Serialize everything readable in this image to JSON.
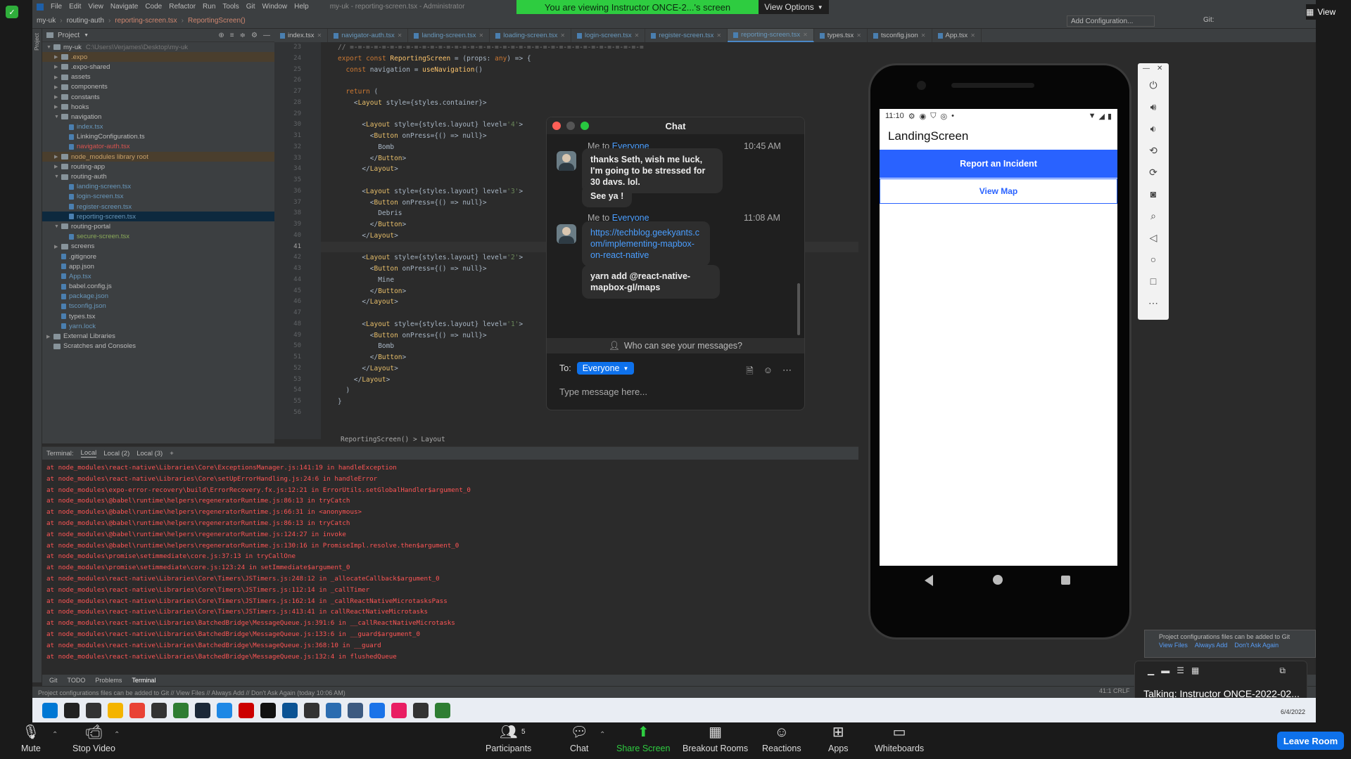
{
  "zoom": {
    "banner_text": "You are viewing Instructor ONCE-2...'s screen",
    "view_options": "View Options",
    "view_label": "View",
    "toolbar": {
      "mute": "Mute",
      "stop_video": "Stop Video",
      "participants": "Participants",
      "participants_count": "5",
      "chat": "Chat",
      "share_screen": "Share Screen",
      "breakout_rooms": "Breakout Rooms",
      "reactions": "Reactions",
      "apps": "Apps",
      "whiteboards": "Whiteboards",
      "leave": "Leave Room"
    },
    "talking": "Talking: Instructor ONCE-2022-02..."
  },
  "ide": {
    "menu": [
      "File",
      "Edit",
      "View",
      "Navigate",
      "Code",
      "Refactor",
      "Run",
      "Tools",
      "Git",
      "Window",
      "Help"
    ],
    "window_title": "my-uk - reporting-screen.tsx - Administrator",
    "breadcrumb": [
      "my-uk",
      "routing-auth",
      "reporting-screen.tsx",
      "ReportingScreen()"
    ],
    "add_configuration": "Add Configuration...",
    "git_label": "Git:",
    "project_label": "Project",
    "project_tree": [
      {
        "indent": 0,
        "arrow": "v",
        "type": "folder",
        "name": "my-uk",
        "suffix": "C:\\Users\\Verjames\\Desktop\\my-uk",
        "color": ""
      },
      {
        "indent": 1,
        "arrow": ">",
        "type": "folder",
        "name": ".expo",
        "color": "excluded"
      },
      {
        "indent": 1,
        "arrow": ">",
        "type": "folder",
        "name": ".expo-shared",
        "color": ""
      },
      {
        "indent": 1,
        "arrow": ">",
        "type": "folder",
        "name": "assets",
        "color": ""
      },
      {
        "indent": 1,
        "arrow": ">",
        "type": "folder",
        "name": "components",
        "color": ""
      },
      {
        "indent": 1,
        "arrow": ">",
        "type": "folder",
        "name": "constants",
        "color": ""
      },
      {
        "indent": 1,
        "arrow": ">",
        "type": "folder",
        "name": "hooks",
        "color": ""
      },
      {
        "indent": 1,
        "arrow": "v",
        "type": "folder",
        "name": "navigation",
        "color": ""
      },
      {
        "indent": 2,
        "arrow": "",
        "type": "file",
        "name": "index.tsx",
        "color": "blue"
      },
      {
        "indent": 2,
        "arrow": "",
        "type": "file",
        "name": "LinkingConfiguration.ts",
        "color": ""
      },
      {
        "indent": 2,
        "arrow": "",
        "type": "file",
        "name": "navigator-auth.tsx",
        "color": "red"
      },
      {
        "indent": 1,
        "arrow": ">",
        "type": "folder",
        "name": "node_modules  library root",
        "color": "excluded"
      },
      {
        "indent": 1,
        "arrow": ">",
        "type": "folder",
        "name": "routing-app",
        "color": ""
      },
      {
        "indent": 1,
        "arrow": "v",
        "type": "folder",
        "name": "routing-auth",
        "color": ""
      },
      {
        "indent": 2,
        "arrow": "",
        "type": "file",
        "name": "landing-screen.tsx",
        "color": "blue"
      },
      {
        "indent": 2,
        "arrow": "",
        "type": "file",
        "name": "login-screen.tsx",
        "color": "blue"
      },
      {
        "indent": 2,
        "arrow": "",
        "type": "file",
        "name": "register-screen.tsx",
        "color": "blue"
      },
      {
        "indent": 2,
        "arrow": "",
        "type": "file",
        "name": "reporting-screen.tsx",
        "color": "selected"
      },
      {
        "indent": 1,
        "arrow": "v",
        "type": "folder",
        "name": "routing-portal",
        "color": ""
      },
      {
        "indent": 2,
        "arrow": "",
        "type": "file",
        "name": "secure-screen.tsx",
        "color": "green"
      },
      {
        "indent": 1,
        "arrow": ">",
        "type": "folder",
        "name": "screens",
        "color": ""
      },
      {
        "indent": 1,
        "arrow": "",
        "type": "file",
        "name": ".gitignore",
        "color": ""
      },
      {
        "indent": 1,
        "arrow": "",
        "type": "file",
        "name": "app.json",
        "color": ""
      },
      {
        "indent": 1,
        "arrow": "",
        "type": "file",
        "name": "App.tsx",
        "color": "blue"
      },
      {
        "indent": 1,
        "arrow": "",
        "type": "file",
        "name": "babel.config.js",
        "color": ""
      },
      {
        "indent": 1,
        "arrow": "",
        "type": "file",
        "name": "package.json",
        "color": "blue"
      },
      {
        "indent": 1,
        "arrow": "",
        "type": "file",
        "name": "tsconfig.json",
        "color": "blue"
      },
      {
        "indent": 1,
        "arrow": "",
        "type": "file",
        "name": "types.tsx",
        "color": ""
      },
      {
        "indent": 1,
        "arrow": "",
        "type": "file",
        "name": "yarn.lock",
        "color": "blue"
      },
      {
        "indent": 0,
        "arrow": ">",
        "type": "folder",
        "name": "External Libraries",
        "color": ""
      },
      {
        "indent": 0,
        "arrow": "",
        "type": "folder",
        "name": "Scratches and Consoles",
        "color": ""
      }
    ],
    "tabs": [
      {
        "name": "index.tsx",
        "active": false
      },
      {
        "name": "navigator-auth.tsx",
        "active": false
      },
      {
        "name": "landing-screen.tsx",
        "active": false
      },
      {
        "name": "loading-screen.tsx",
        "active": false
      },
      {
        "name": "login-screen.tsx",
        "active": false
      },
      {
        "name": "register-screen.tsx",
        "active": false
      },
      {
        "name": "reporting-screen.tsx",
        "active": true
      },
      {
        "name": "types.tsx",
        "active": false
      },
      {
        "name": "tsconfig.json",
        "active": false
      },
      {
        "name": "App.tsx",
        "active": false
      }
    ],
    "line_numbers": [
      "23",
      "24",
      "25",
      "26",
      "27",
      "28",
      "29",
      "30",
      "31",
      "32",
      "33",
      "34",
      "35",
      "36",
      "37",
      "38",
      "39",
      "40",
      "41",
      "42",
      "43",
      "44",
      "45",
      "46",
      "47",
      "48",
      "49",
      "50",
      "51",
      "52",
      "53",
      "54",
      "55",
      "56"
    ],
    "code_lines": [
      "// =-=-=-=-=-=-=-=-=-=-=-=-=-=-=-=-=-=-=-=-=-=-=-=-=-=-=-=-=-=-=-=-=-=-=-=-=",
      "export const ReportingScreen = (props: any) => {",
      "  const navigation = useNavigation()",
      "",
      "  return (",
      "    <Layout style={styles.container}>",
      "",
      "      <Layout style={styles.layout} level='4'>",
      "        <Button onPress={() => null}>",
      "          Bomb",
      "        </Button>",
      "      </Layout>",
      "",
      "      <Layout style={styles.layout} level='3'>",
      "        <Button onPress={() => null}>",
      "          Debris",
      "        </Button>",
      "      </Layout>",
      "",
      "      <Layout style={styles.layout} level='2'>",
      "        <Button onPress={() => null}>",
      "          Mine",
      "        </Button>",
      "      </Layout>",
      "",
      "      <Layout style={styles.layout} level='1'>",
      "        <Button onPress={() => null}>",
      "          Bomb",
      "        </Button>",
      "      </Layout>",
      "    </Layout>",
      "  )",
      "}",
      ""
    ],
    "code_breadcrumb": "ReportingScreen()  >  Layout",
    "terminal_tabs": [
      "Terminal:",
      "Local",
      "Local (2)",
      "Local (3)"
    ],
    "terminal_lines": [
      "at node_modules\\react-native\\Libraries\\Core\\ExceptionsManager.js:141:19 in handleException",
      "at node_modules\\react-native\\Libraries\\Core\\setUpErrorHandling.js:24:6 in handleError",
      "at node_modules\\expo-error-recovery\\build\\ErrorRecovery.fx.js:12:21 in ErrorUtils.setGlobalHandler$argument_0",
      "at node_modules\\@babel\\runtime\\helpers\\regeneratorRuntime.js:86:13 in tryCatch",
      "at node_modules\\@babel\\runtime\\helpers\\regeneratorRuntime.js:66:31 in <anonymous>",
      "at node_modules\\@babel\\runtime\\helpers\\regeneratorRuntime.js:86:13 in tryCatch",
      "at node_modules\\@babel\\runtime\\helpers\\regeneratorRuntime.js:124:27 in invoke",
      "at node_modules\\@babel\\runtime\\helpers\\regeneratorRuntime.js:130:16 in PromiseImpl.resolve.then$argument_0",
      "at node_modules\\promise\\setimmediate\\core.js:37:13 in tryCallOne",
      "at node_modules\\promise\\setimmediate\\core.js:123:24 in setImmediate$argument_0",
      "at node_modules\\react-native\\Libraries\\Core\\Timers\\JSTimers.js:248:12 in _allocateCallback$argument_0",
      "at node_modules\\react-native\\Libraries\\Core\\Timers\\JSTimers.js:112:14 in _callTimer",
      "at node_modules\\react-native\\Libraries\\Core\\Timers\\JSTimers.js:162:14 in _callReactNativeMicrotasksPass",
      "at node_modules\\react-native\\Libraries\\Core\\Timers\\JSTimers.js:413:41 in callReactNativeMicrotasks",
      "at node_modules\\react-native\\Libraries\\BatchedBridge\\MessageQueue.js:391:6 in __callReactNativeMicrotasks",
      "at node_modules\\react-native\\Libraries\\BatchedBridge\\MessageQueue.js:133:6 in __guard$argument_0",
      "at node_modules\\react-native\\Libraries\\BatchedBridge\\MessageQueue.js:368:10 in __guard",
      "at node_modules\\react-native\\Libraries\\BatchedBridge\\MessageQueue.js:132:4 in flushedQueue"
    ],
    "bottom_tabs": [
      "Git",
      "TODO",
      "Problems",
      "Terminal"
    ],
    "status_text": "Project configurations files can be added to Git // View Files // Always Add // Don't Ask Again (today 10:06 AM)",
    "status_right": "41:1  CRLF",
    "notification": {
      "text": "Project configurations files can be added to Git",
      "links": [
        "View Files",
        "Always Add",
        "Don't Ask Again"
      ]
    },
    "taskbar_date": "6/4/2022"
  },
  "emulator": {
    "time": "11:10",
    "app_title": "LandingScreen",
    "report_button": "Report an Incident",
    "view_map_button": "View Map"
  },
  "chat": {
    "title": "Chat",
    "messages": [
      {
        "from": "Me to",
        "to": "Everyone",
        "time": "10:45 AM",
        "bubbles": [
          "thanks Seth, wish me luck, I'm going to be stressed for 30 days. lol.",
          "See ya !"
        ]
      },
      {
        "from": "Me to",
        "to": "Everyone",
        "time": "11:08 AM",
        "bubbles": [
          "https://techblog.geekyants.com/implementing-mapbox-on-react-native",
          "yarn add @react-native-mapbox-gl/maps"
        ]
      }
    ],
    "who_can_see": "Who can see your messages?",
    "to_label": "To:",
    "to_value": "Everyone",
    "input_placeholder": "Type message here..."
  }
}
